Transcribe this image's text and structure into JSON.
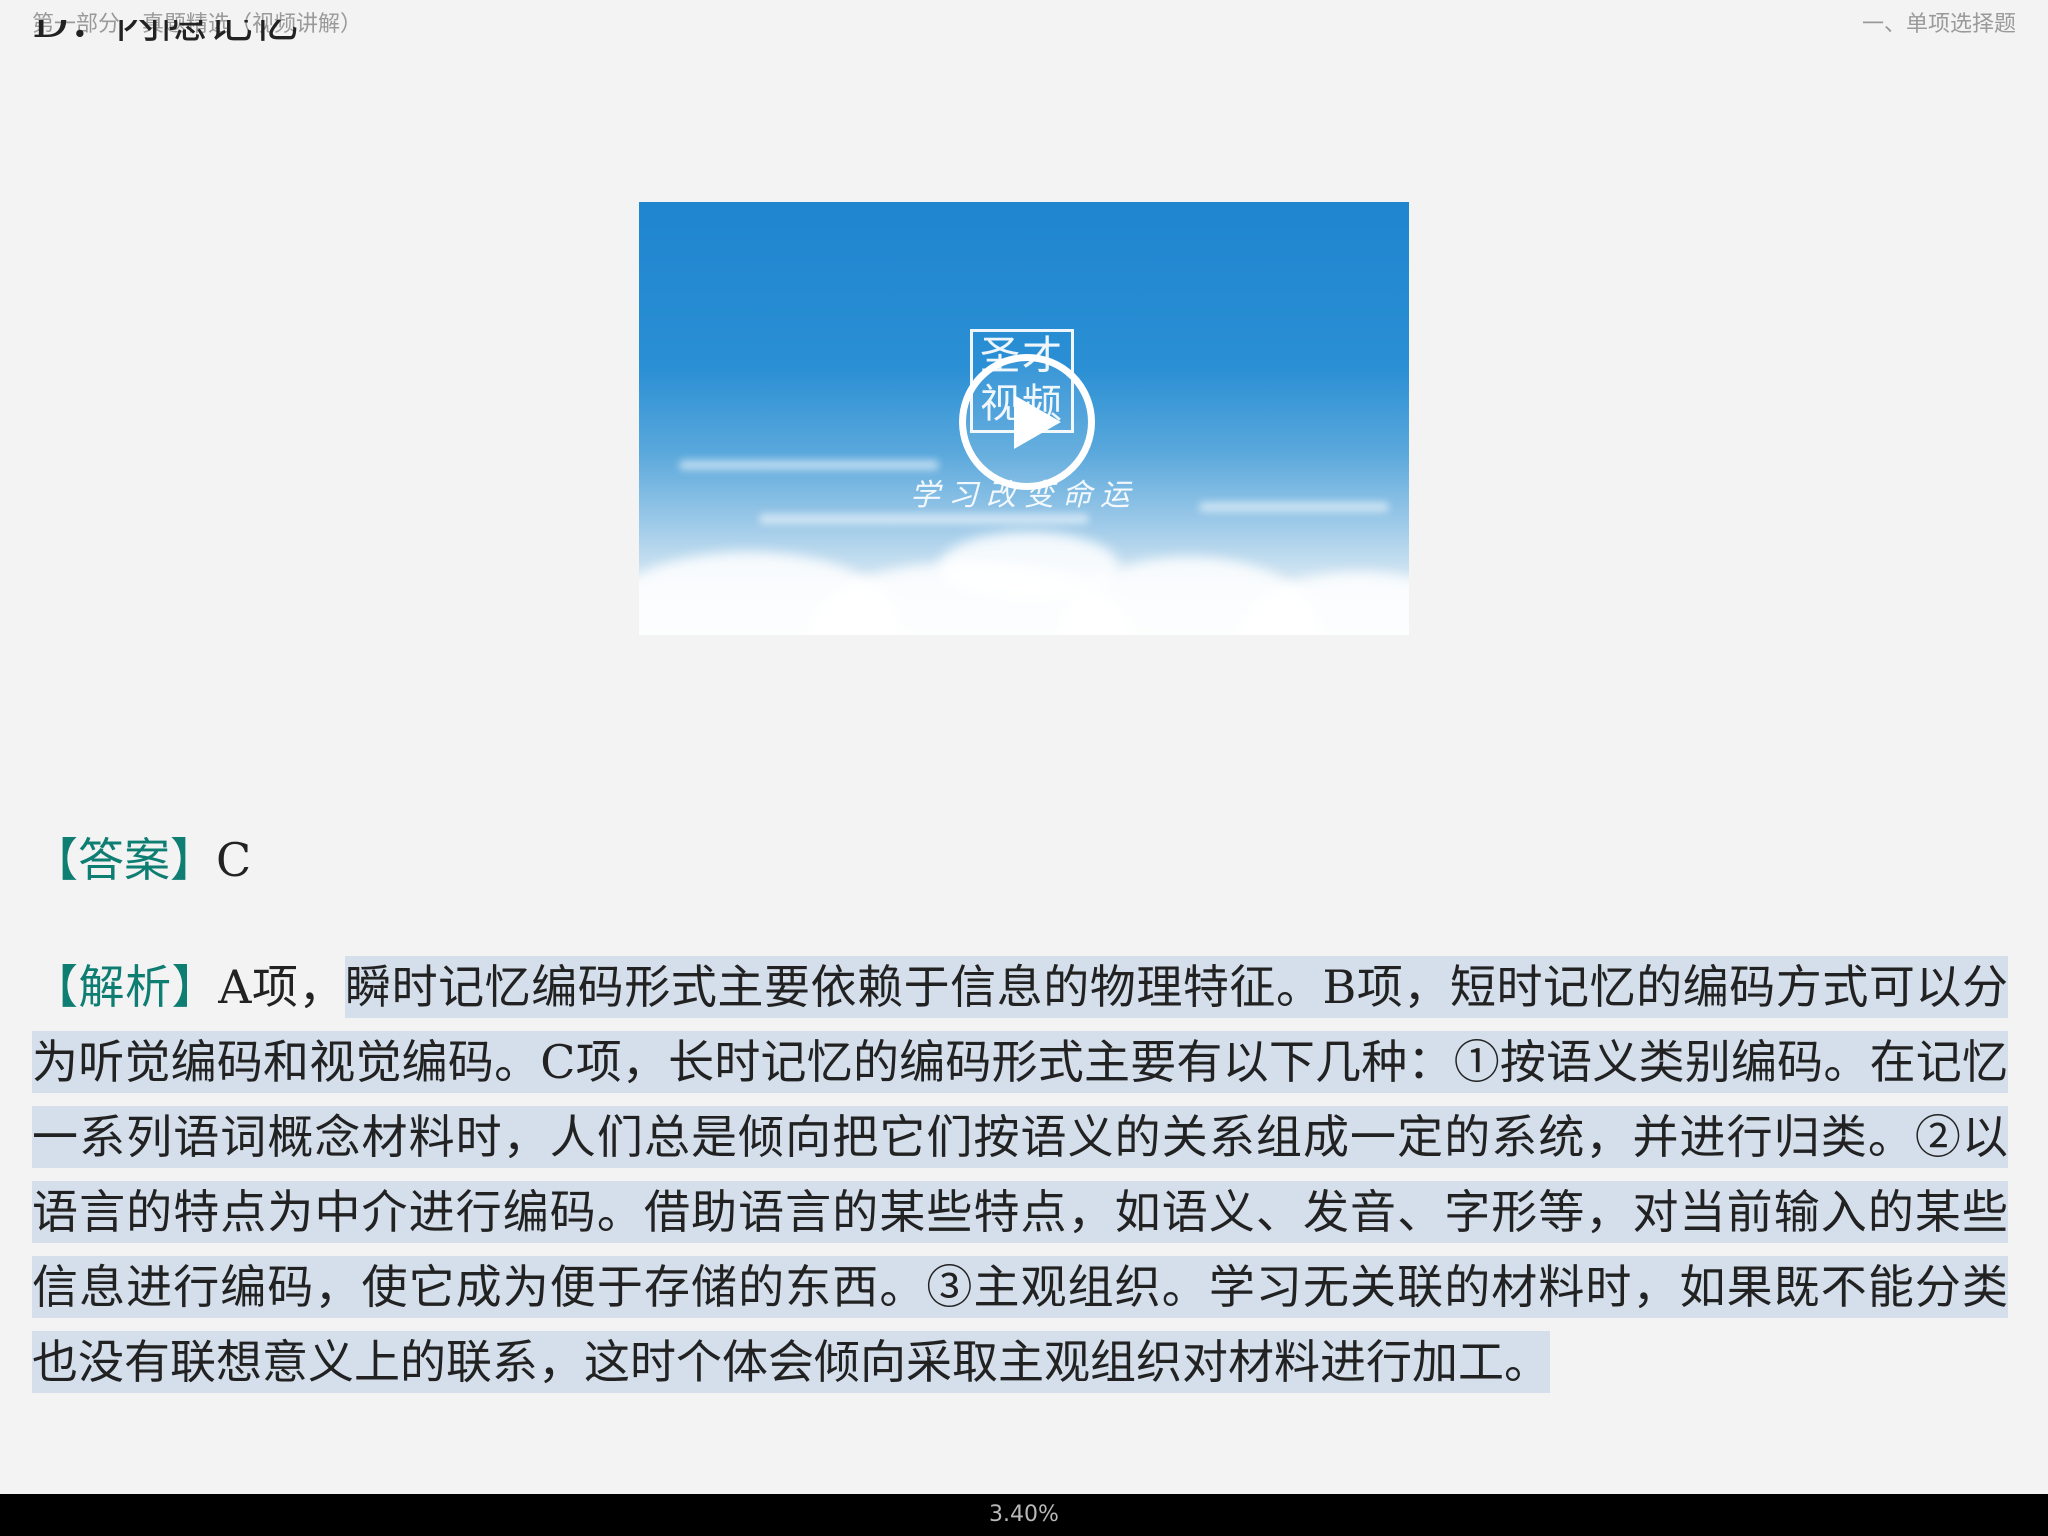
{
  "header": {
    "chapter": "第一部分　真题精选（视频讲解）",
    "section": "一、单项选择题"
  },
  "previous_option": "D．内隐记忆",
  "video": {
    "logo_line1": "圣才",
    "logo_line2": "视频",
    "tagline": "学习改变命运",
    "play_icon": "play-circle-icon"
  },
  "answer": {
    "label": "【答案】",
    "value": "C"
  },
  "analysis": {
    "label": "【解析】",
    "lead": "A项，",
    "highlighted": "瞬时记忆编码形式主要依赖于信息的物理特征。B项，短时记忆的编码方式可以分为听觉编码和视觉编码。C项，长时记忆的编码形式主要有以下几种：①按语义类别编码。在记忆一系列语词概念材料时，人们总是倾向把它们按语义的关系组成一定的系统，并进行归类。②以语言的特点为中介进行编码。借助语言的某些特点，如语义、发音、字形等，对当前输入的某些信息进行编码，使它成为便于存储的东西。③主观组织。学习无关联的材料时，如果既不能分类也没有联想意义上的联系，这时个体会倾向采取主观组织对材料进行加工。"
  },
  "footer": {
    "progress_text": "3.40%"
  },
  "colors": {
    "label_teal": "#0e7d72",
    "highlight": "#d4dfeb",
    "background": "#f3f3f3"
  }
}
